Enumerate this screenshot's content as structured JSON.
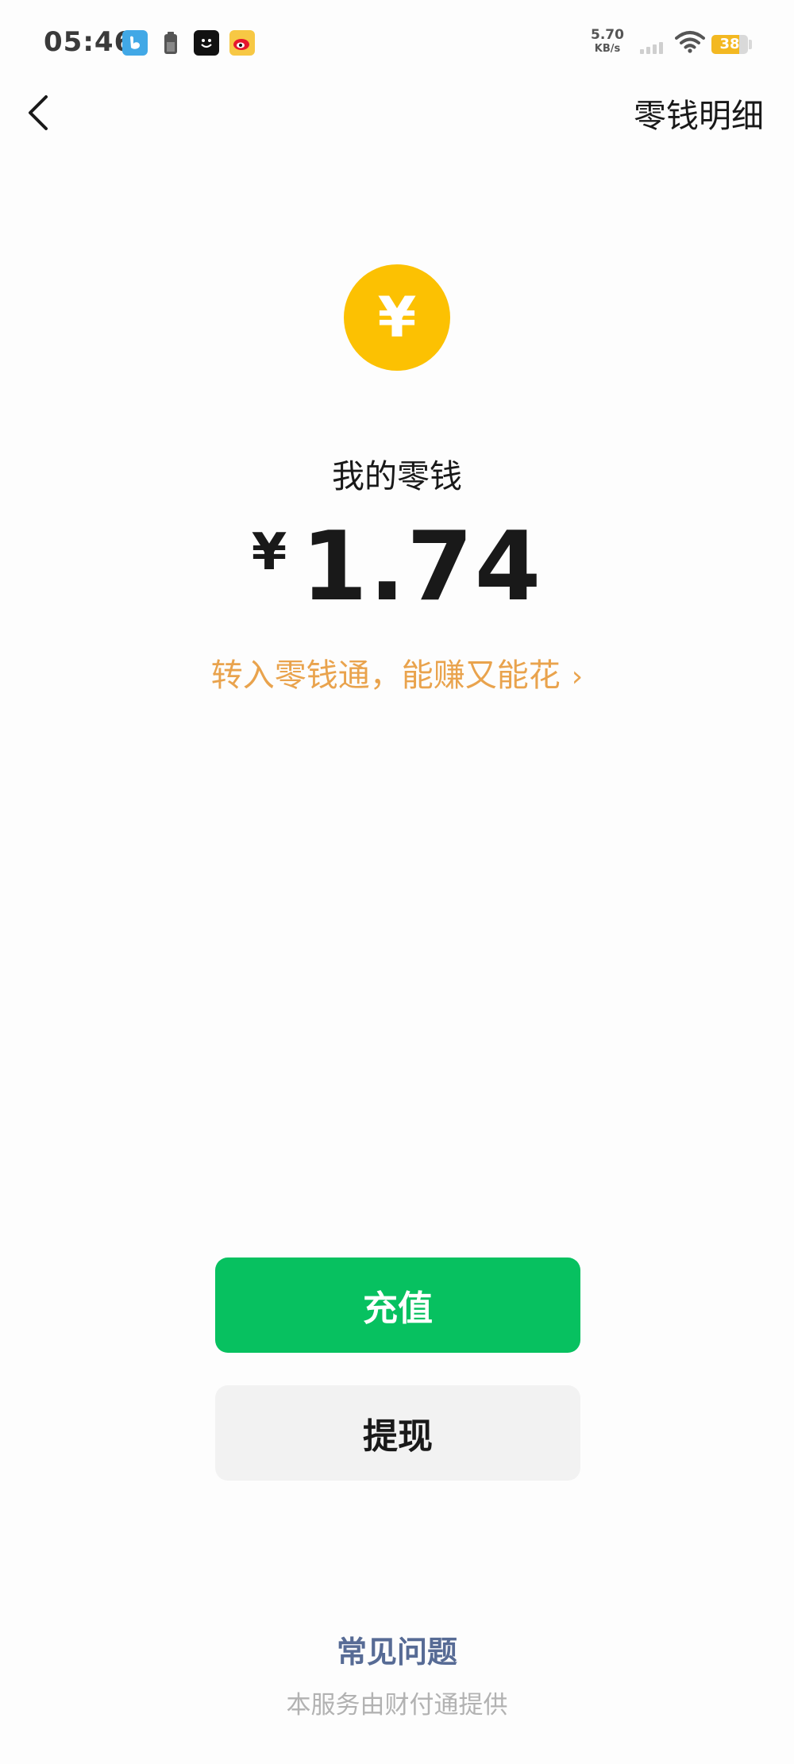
{
  "status_bar": {
    "time": "05:46",
    "net_speed_value": "5.70",
    "net_speed_unit": "KB/s",
    "battery_level": "38",
    "battery_fraction": 0.38,
    "notification_icons": [
      "app-icon",
      "battery-saver-icon",
      "message-icon",
      "weibo-icon"
    ]
  },
  "nav": {
    "back_icon": "chevron-left-icon",
    "right_action": "零钱明细"
  },
  "balance": {
    "coin_symbol": "¥",
    "label": "我的零钱",
    "currency": "¥",
    "amount": "1.74",
    "promo_text": "转入零钱通，能赚又能花",
    "promo_chevron": "›"
  },
  "actions": {
    "recharge_label": "充值",
    "withdraw_label": "提现"
  },
  "footer": {
    "faq_label": "常见问题",
    "provider_note": "本服务由财付通提供"
  },
  "colors": {
    "accent_green": "#07c160",
    "coin_yellow": "#fcc102",
    "promo_orange": "#e9a34d",
    "link_blue": "#576b95"
  }
}
